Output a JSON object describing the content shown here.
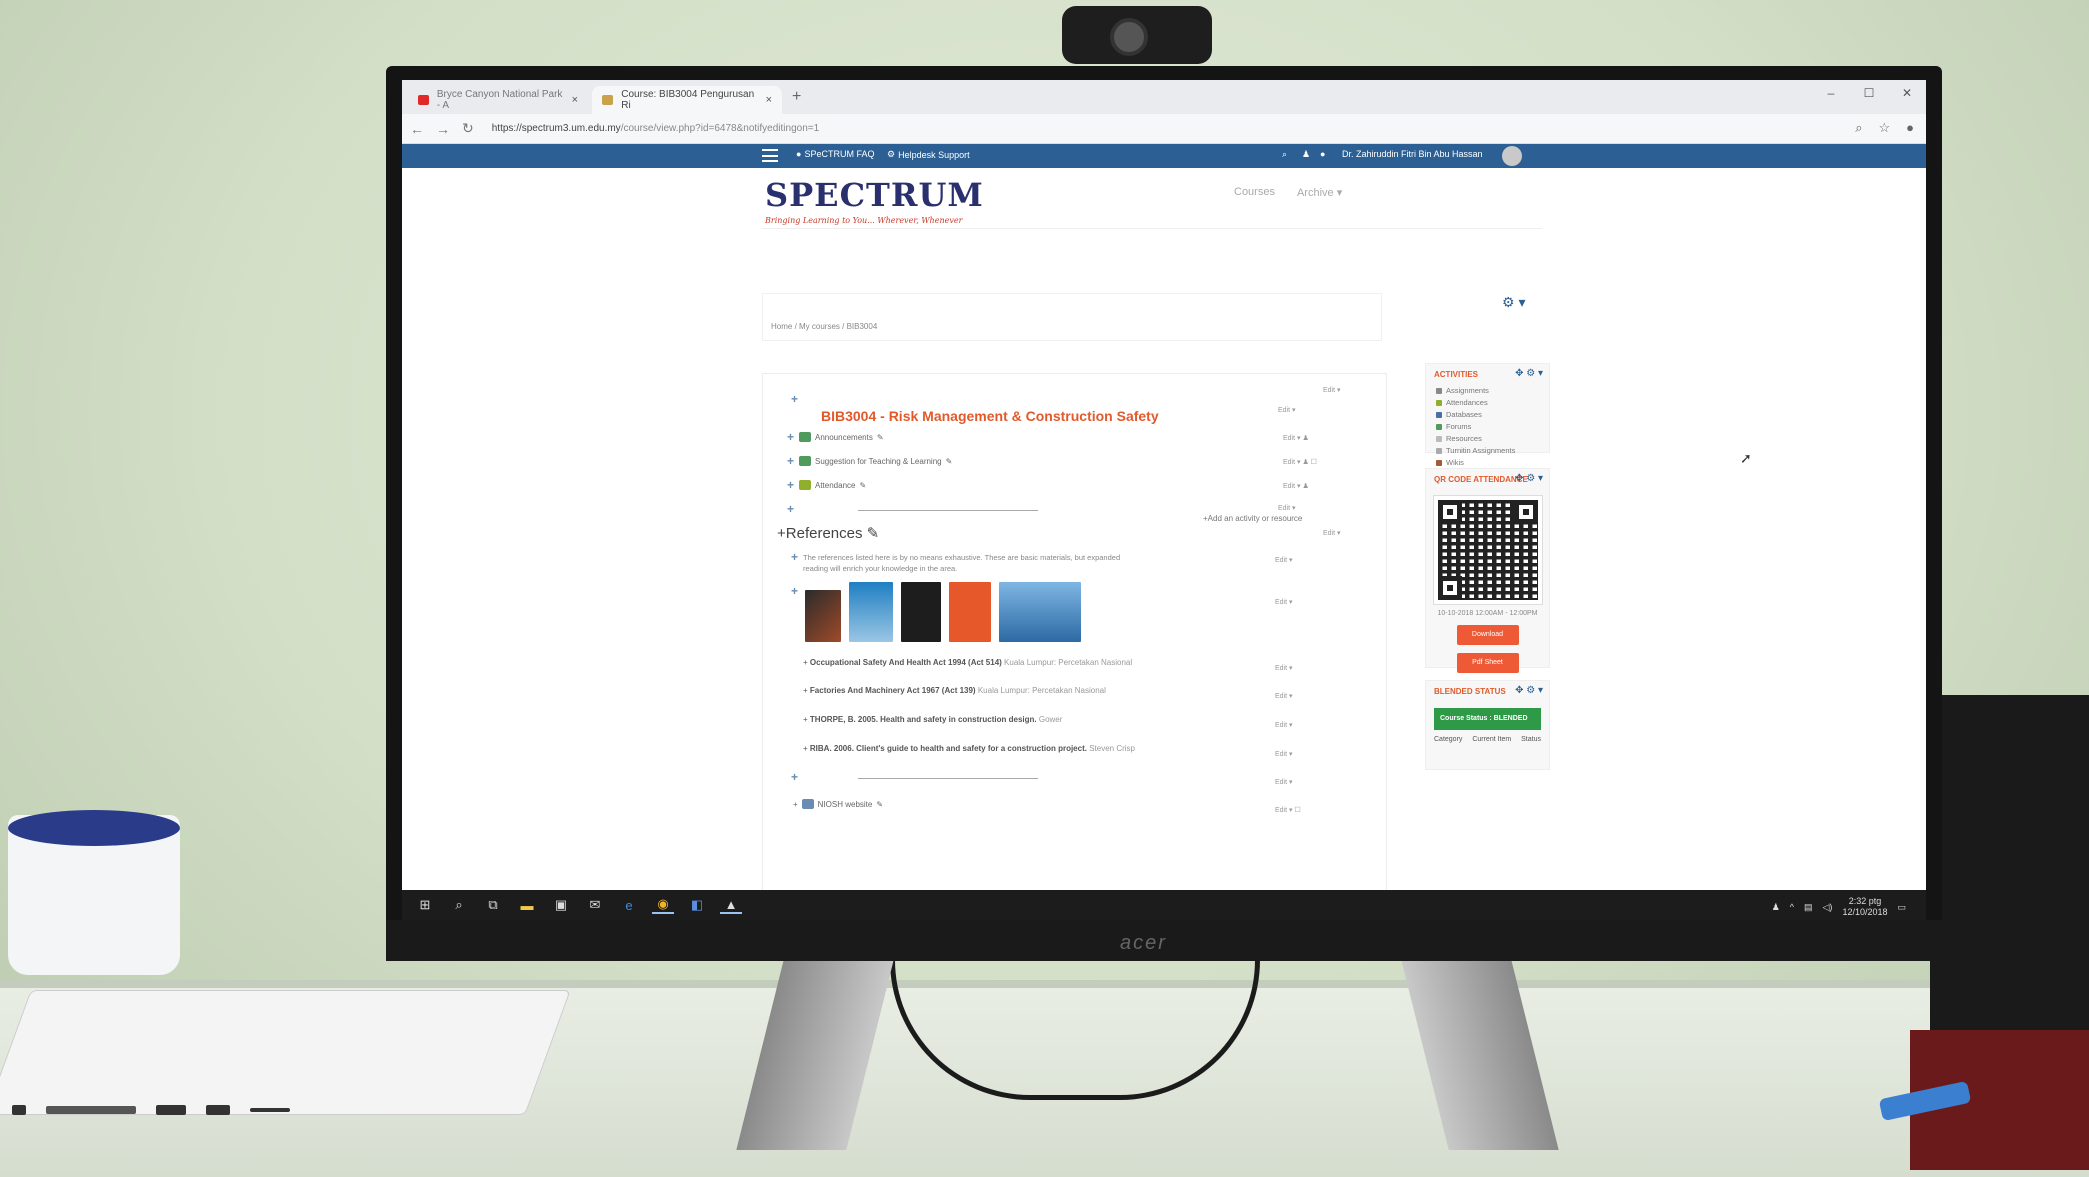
{
  "monitor": {
    "brand": "acer"
  },
  "browser": {
    "tabs": [
      {
        "label": "Bryce Canyon National Park - A",
        "active": false
      },
      {
        "label": "Course: BIB3004 Pengurusan Ri",
        "active": true
      }
    ],
    "url_host": "https://spectrum3.um.edu.my",
    "url_path": "/course/view.php?id=6478&notifyeditingon=1"
  },
  "site_nav": {
    "faq": "SPeCTRUM FAQ",
    "helpdesk": "Helpdesk Support",
    "user_name": "Dr. Zahiruddin Fitri Bin Abu Hassan"
  },
  "logo": {
    "title": "SPECTRUM",
    "tagline": "Bringing Learning to You... Wherever, Whenever"
  },
  "top_nav": {
    "courses": "Courses",
    "archive": "Archive"
  },
  "breadcrumb": "Home / My courses / BIB3004",
  "course": {
    "title": "BIB3004 - Risk Management & Construction Safety",
    "edit_label": "Edit",
    "activities": [
      {
        "label": "Announcements"
      },
      {
        "label": "Suggestion for Teaching & Learning"
      },
      {
        "label": "Attendance"
      }
    ],
    "add_activity": "Add an activity or resource"
  },
  "references": {
    "heading": "References",
    "description": "The references listed here is by no means exhaustive. These are basic materials, but expanded reading will enrich your knowledge in the area.",
    "items": [
      {
        "bold": "Occupational Safety And Health Act 1994 (Act 514)",
        "rest": "Kuala Lumpur: Percetakan Nasional"
      },
      {
        "bold": "Factories And Machinery Act 1967 (Act 139)",
        "rest": "Kuala Lumpur: Percetakan Nasional"
      },
      {
        "bold": "THORPE, B. 2005. Health and safety in construction design.",
        "rest": "Gower"
      },
      {
        "bold": "RIBA. 2006. Client's guide to health and safety for a construction project.",
        "rest": "Steven Crisp"
      }
    ],
    "website": "NIOSH website"
  },
  "blocks": {
    "activities": {
      "title": "ACTIVITIES",
      "items": [
        "Assignments",
        "Attendances",
        "Databases",
        "Forums",
        "Resources",
        "Turnitin Assignments",
        "Wikis"
      ]
    },
    "qr": {
      "title": "QR CODE ATTENDANCE",
      "time": "10-10-2018 12:00AM - 12:00PM",
      "download": "Download",
      "pdf": "Pdf Sheet"
    },
    "blended": {
      "title": "BLENDED STATUS",
      "status": "Course Status : BLENDED",
      "col1": "Category",
      "col2": "Current Item",
      "col3": "Status"
    }
  },
  "taskbar": {
    "time": "2:32 ptg",
    "date": "12/10/2018"
  },
  "colors": {
    "navbar": "#2c5f93",
    "accent": "#e25a2c",
    "status_green": "#2e9a48",
    "button_orange": "#ee5a35"
  }
}
